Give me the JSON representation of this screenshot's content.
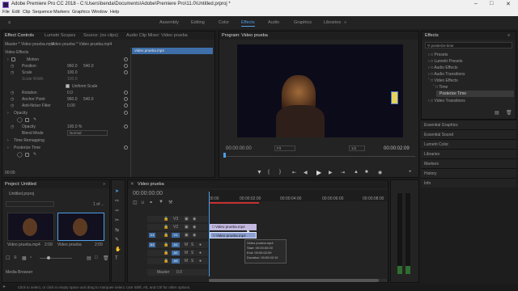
{
  "app": {
    "title": "Adobe Premiere Pro CC 2018 - C:\\Users\\benda\\Documents\\Adobe\\Premiere Pro\\11.0\\Untitled.prproj *"
  },
  "menu": [
    "File",
    "Edit",
    "Clip",
    "Sequence",
    "Markers",
    "Graphics",
    "Window",
    "Help"
  ],
  "workspaces": [
    "Assembly",
    "Editing",
    "Color",
    "Effects",
    "Audio",
    "Graphics",
    "Libraries"
  ],
  "active_workspace": "Effects",
  "source_tabs": [
    "Effect Controls",
    "Lumetri Scopes",
    "Source: (no clips)",
    "Audio Clip Mixer: Video prueba"
  ],
  "ec": {
    "master": "Master * Video prueba.mp4",
    "clip": "Video prueba * Video prueba.mp4",
    "mini_clip": "Video prueba.mp4",
    "timecode": "00:00",
    "video_effects": "Video Effects",
    "motion": "Motion",
    "position": "Position",
    "position_x": "960.0",
    "position_y": "540.0",
    "scale": "Scale",
    "scale_val": "100.0",
    "scale_width": "Scale Width",
    "scale_width_val": "100.0",
    "uniform_scale": "Uniform Scale",
    "rotation": "Rotation",
    "rotation_val": "0.0",
    "anchor": "Anchor Point",
    "anchor_x": "960.0",
    "anchor_y": "540.0",
    "anti_flicker": "Anti-flicker Filter",
    "anti_flicker_val": "0.00",
    "opacity": "Opacity",
    "opacity_row": "Opacity",
    "opacity_val": "100.0 %",
    "blend_mode": "Blend Mode",
    "blend_val": "Normal",
    "time_remap": "Time Remapping",
    "posterize": "Posterize Time"
  },
  "program": {
    "tab": "Program: Video prueba",
    "timecode": "00:00:00:00",
    "fit": "Fit",
    "quality": "1/2",
    "duration": "00:00:02:09"
  },
  "effects_panel": {
    "tab": "Effects",
    "search": "posterize time",
    "items": [
      "Presets",
      "Lumetri Presets",
      "Audio Effects",
      "Audio Transitions",
      "Video Effects",
      "Time",
      "Posterize Time",
      "Video Transitions"
    ]
  },
  "side_panels": [
    "Essential Graphics",
    "Essential Sound",
    "Lumetri Color",
    "Libraries",
    "Markers",
    "History",
    "Info"
  ],
  "project": {
    "tab": "Project: Untitled",
    "file": "Untitled.prproj",
    "count": "1 of ...",
    "item1": "Video prueba.mp4",
    "item1_dur": "2:09",
    "item2": "Video prueba",
    "item2_dur": "2:09",
    "media_browser": "Media Browser"
  },
  "timeline": {
    "tab": "Video prueba",
    "timecode": "00:00:00:00",
    "ruler": [
      "00:00",
      "00:00:02:00",
      "00:00:04:00",
      "00:00:06:00",
      "00:00:08:00"
    ],
    "tracks_v": [
      "V3",
      "V2",
      "V1"
    ],
    "tracks_a": [
      "A1",
      "A2",
      "A3"
    ],
    "master": "Master",
    "master_val": "0.0",
    "clip_v2": "Video prueba.mp4",
    "clip_v1": "Video prueba.mp4",
    "tooltip": [
      "Video prueba.mp4",
      "Start: 00:00:00:00",
      "End: 00:00:02:09",
      "Duration: 00:00:02:10"
    ]
  },
  "status": "Click to select, or click in empty space and drag to marquee select. Use Shift, Alt, and Ctrl for other options.",
  "colors": {
    "accent": "#4c9fe8",
    "clip_video": "#8c9fd0",
    "clip_audio": "#6ca86a",
    "panel": "#232323"
  }
}
